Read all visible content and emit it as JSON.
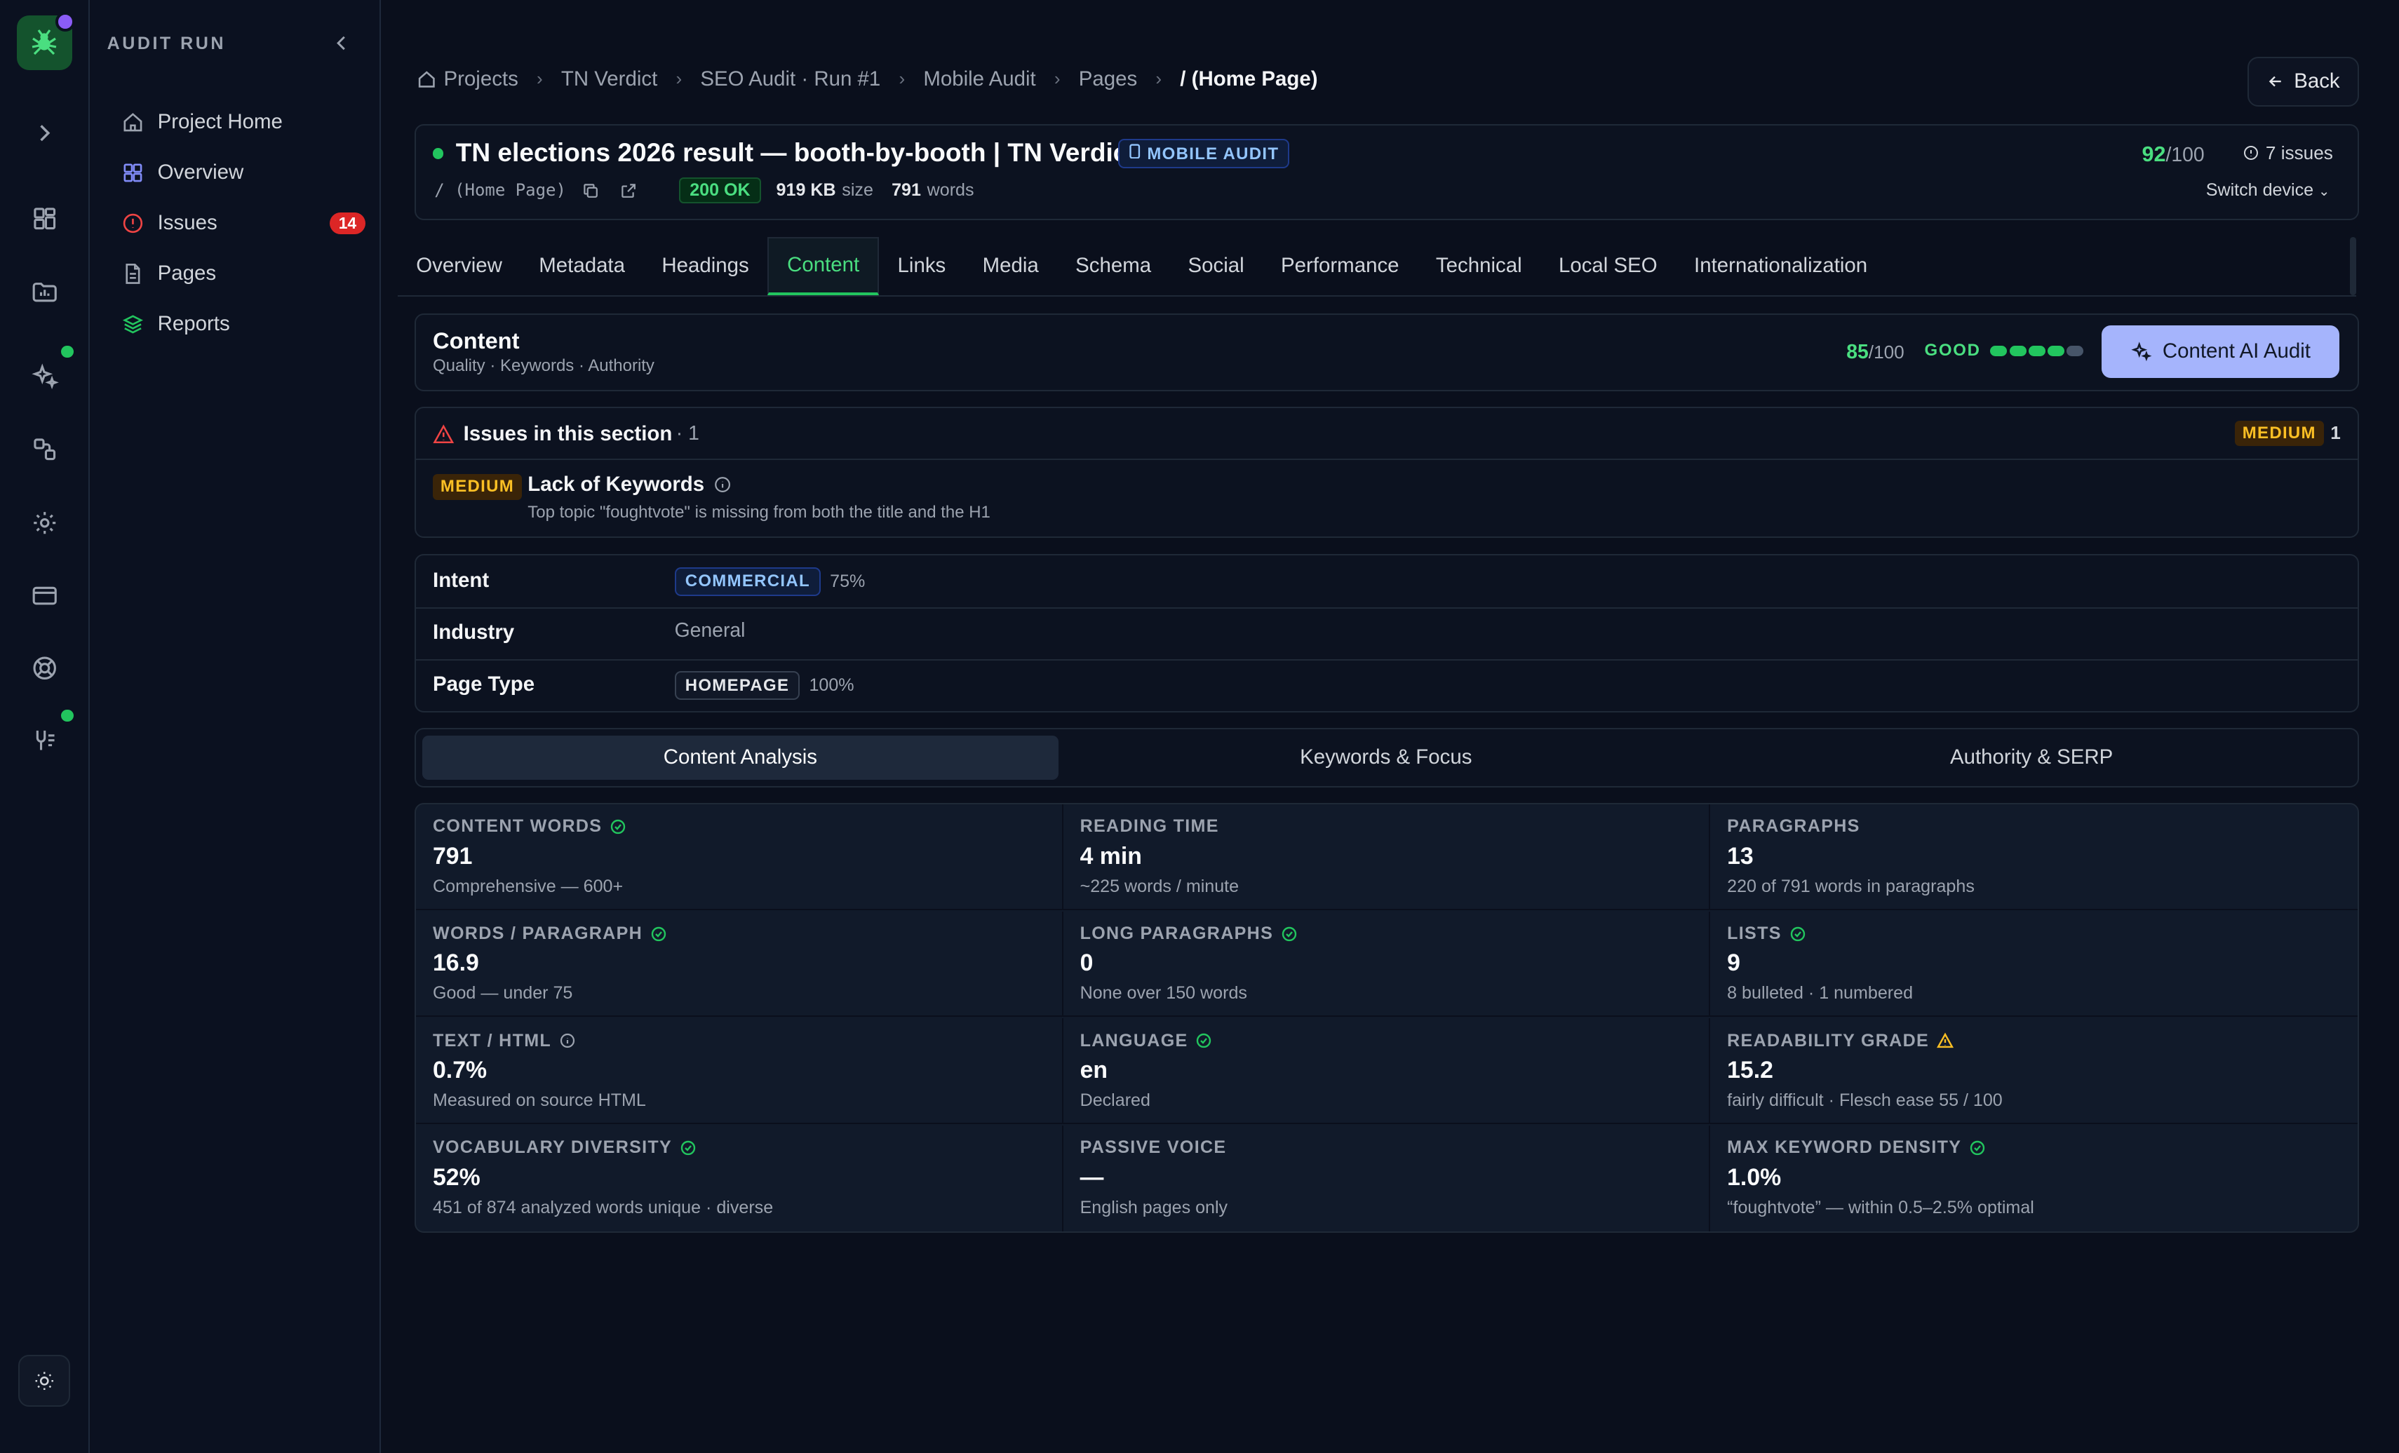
{
  "sidebar": {
    "header": "AUDIT RUN",
    "items": [
      {
        "label": "Project Home"
      },
      {
        "label": "Overview"
      },
      {
        "label": "Issues",
        "badge": "14"
      },
      {
        "label": "Pages"
      },
      {
        "label": "Reports"
      }
    ]
  },
  "breadcrumb": [
    "Projects",
    "TN Verdict",
    "SEO Audit · Run #1",
    "Mobile Audit",
    "Pages",
    "/ (Home Page)"
  ],
  "back_label": "Back",
  "page": {
    "title": "TN elections 2026 result — booth-by-booth | TN Verdict",
    "badge": "MOBILE AUDIT",
    "path": "/ (Home Page)",
    "status": "200 OK",
    "size_value": "919 KB",
    "size_label": "size",
    "words_value": "791",
    "words_label": "words",
    "score": "92",
    "score_max": "/100",
    "issues": "7 issues",
    "switch_device": "Switch device"
  },
  "tabs": [
    "Overview",
    "Metadata",
    "Headings",
    "Content",
    "Links",
    "Media",
    "Schema",
    "Social",
    "Performance",
    "Technical",
    "Local SEO",
    "Internationalization"
  ],
  "active_tab": "Content",
  "section": {
    "title": "Content",
    "subtitle": "Quality · Keywords · Authority",
    "score": "85",
    "score_max": "/100",
    "rating": "GOOD",
    "rating_level": 4,
    "rating_max": 5,
    "ai_button": "Content AI Audit"
  },
  "issues_section": {
    "title": "Issues in this section",
    "count": "· 1",
    "severity_badge": "MEDIUM",
    "severity_count": "1",
    "items": [
      {
        "severity": "MEDIUM",
        "title": "Lack of Keywords",
        "description": "Top topic \"foughtvote\" is missing from both the title and the H1"
      }
    ]
  },
  "properties": [
    {
      "key": "Intent",
      "pill": "COMMERCIAL",
      "pct": "75%"
    },
    {
      "key": "Industry",
      "value": "General"
    },
    {
      "key": "Page Type",
      "pill": "HOMEPAGE",
      "pct": "100%"
    }
  ],
  "subtabs": [
    "Content Analysis",
    "Keywords & Focus",
    "Authority & SERP"
  ],
  "metrics": [
    {
      "label": "CONTENT WORDS",
      "icon": "check-circle-icon",
      "value": "791",
      "sub": "Comprehensive — 600+"
    },
    {
      "label": "READING TIME",
      "value": "4 min",
      "sub": "~225 words / minute"
    },
    {
      "label": "PARAGRAPHS",
      "value": "13",
      "sub": "220 of 791 words in paragraphs"
    },
    {
      "label": "WORDS / PARAGRAPH",
      "icon": "check-circle-icon",
      "value": "16.9",
      "sub": "Good — under 75"
    },
    {
      "label": "LONG PARAGRAPHS",
      "icon": "check-circle-icon",
      "value": "0",
      "sub": "None over 150 words"
    },
    {
      "label": "LISTS",
      "icon": "check-circle-icon",
      "value": "9",
      "sub": "8 bulleted · 1 numbered"
    },
    {
      "label": "TEXT / HTML",
      "icon": "info-icon",
      "value": "0.7%",
      "sub": "Measured on source HTML"
    },
    {
      "label": "LANGUAGE",
      "icon": "check-circle-icon",
      "value": "en",
      "sub": "Declared"
    },
    {
      "label": "READABILITY GRADE",
      "icon": "warning-icon",
      "value": "15.2",
      "sub": "fairly difficult · Flesch ease 55 / 100"
    },
    {
      "label": "VOCABULARY DIVERSITY",
      "icon": "check-circle-icon",
      "value": "52%",
      "sub": "451 of 874 analyzed words unique · diverse"
    },
    {
      "label": "PASSIVE VOICE",
      "value": "—",
      "sub": "English pages only"
    },
    {
      "label": "MAX KEYWORD DENSITY",
      "icon": "check-circle-icon",
      "value": "1.0%",
      "sub": "“foughtvote” — within 0.5–2.5% optimal"
    }
  ],
  "colors": {
    "accent": "#22c55e",
    "warning": "#fbbf24",
    "danger": "#dc2626",
    "ai_button": "#a5b4fc"
  }
}
